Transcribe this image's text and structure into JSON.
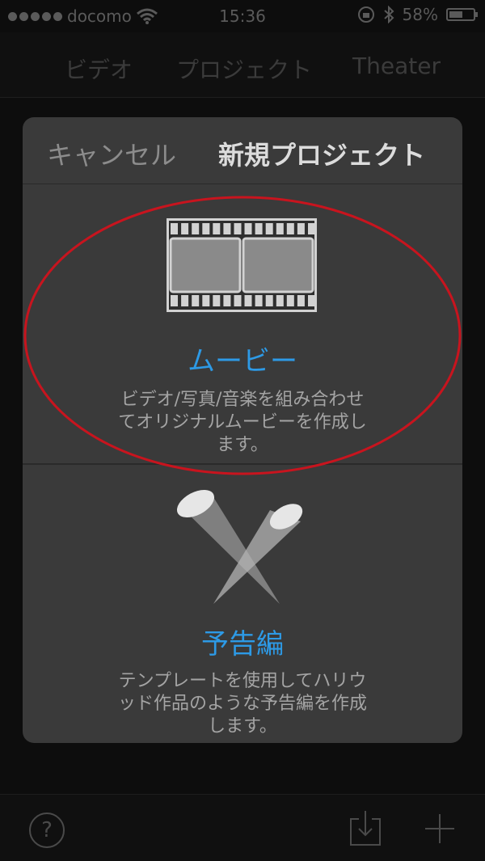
{
  "status": {
    "carrier": "docomo",
    "time": "15:36",
    "battery": "58%",
    "battery_level": 0.58
  },
  "tabs": [
    {
      "label": "ビデオ"
    },
    {
      "label": "プロジェクト"
    },
    {
      "label": "Theater"
    }
  ],
  "dialog": {
    "cancel_label": "キャンセル",
    "title": "新規プロジェクト",
    "options": [
      {
        "title": "ムービー",
        "desc_lines": [
          "ビデオ/写真/音楽を組み合わせ",
          "てオリジナルムービーを作成し",
          "ます。"
        ]
      },
      {
        "title": "予告編",
        "desc_lines": [
          "テンプレートを使用してハリウ",
          "ッド作品のような予告編を作成",
          "します。"
        ]
      }
    ]
  },
  "toolbar": {
    "help_label": "?"
  },
  "colors": {
    "accent": "#2d9ae6",
    "annotation": "#c8141e",
    "dialog_bg": "#3a3a3a"
  },
  "icons": [
    "film-strip-icon",
    "spotlight-icon",
    "help-icon",
    "download-icon",
    "plus-icon",
    "wifi-icon"
  ]
}
